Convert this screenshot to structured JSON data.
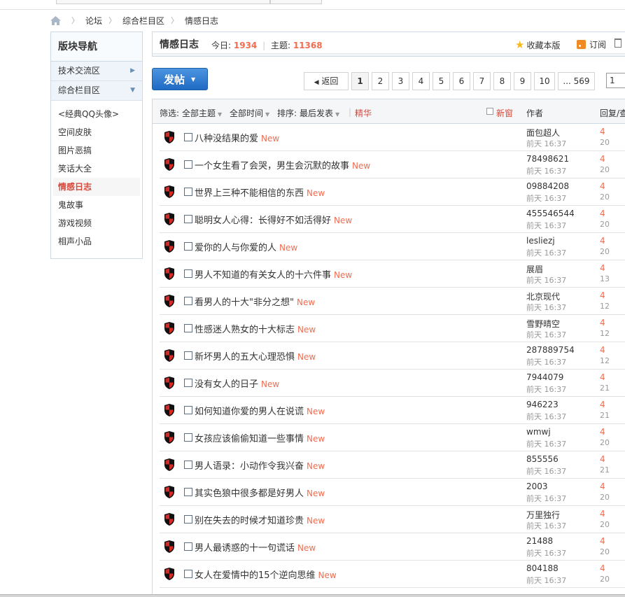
{
  "breadcrumb": {
    "items": [
      "论坛",
      "综合栏目区",
      "情感日志"
    ]
  },
  "sidebar": {
    "title": "版块导航",
    "groups": [
      {
        "label": "技术交流区",
        "arrow": "▶"
      },
      {
        "label": "综合栏目区",
        "arrow": "▼"
      }
    ],
    "items": [
      {
        "label": "<经典QQ头像>"
      },
      {
        "label": "空间皮肤"
      },
      {
        "label": "图片恶搞"
      },
      {
        "label": "笑话大全"
      },
      {
        "label": "情感日志",
        "active": true
      },
      {
        "label": "鬼故事"
      },
      {
        "label": "游戏视频"
      },
      {
        "label": "相声小品"
      }
    ]
  },
  "forum": {
    "name": "情感日志",
    "today_label": "今日:",
    "today_value": "1934",
    "threads_label": "主题:",
    "threads_value": "11368",
    "favorite_label": "收藏本版",
    "subscribe_label": "订阅"
  },
  "post_button": {
    "label": "发帖"
  },
  "pager": {
    "back": "返回",
    "pages": [
      "1",
      "2",
      "3",
      "4",
      "5",
      "6",
      "7",
      "8",
      "9",
      "10",
      "... 569"
    ],
    "current": "1",
    "input_value": "1"
  },
  "filters": {
    "filter_label": "筛选:",
    "all_threads": "全部主题",
    "all_time": "全部时间",
    "sort_label": "排序:",
    "sort_value": "最后发表",
    "digest": "精华",
    "new_window": "新窗",
    "col_author": "作者",
    "col_replies": "回复/查"
  },
  "new_badge": "New",
  "threads": [
    {
      "title": "八种没结果的爱",
      "author": "面包超人",
      "time": "前天 16:37",
      "replies": "4",
      "views": "20"
    },
    {
      "title": "一个女生看了会哭，男生会沉默的故事",
      "author": "78498621",
      "time": "前天 16:37",
      "replies": "4",
      "views": "20"
    },
    {
      "title": "世界上三种不能相信的东西",
      "author": "09884208",
      "time": "前天 16:37",
      "replies": "4",
      "views": "20"
    },
    {
      "title": "聪明女人心得：长得好不如活得好",
      "author": "455546544",
      "time": "前天 16:37",
      "replies": "4",
      "views": "20"
    },
    {
      "title": "爱你的人与你爱的人",
      "author": "lesliezj",
      "time": "前天 16:37",
      "replies": "4",
      "views": "20"
    },
    {
      "title": "男人不知道的有关女人的十六件事",
      "author": "展眉",
      "time": "前天 16:37",
      "replies": "4",
      "views": "13"
    },
    {
      "title": "看男人的十大\"非分之想\"",
      "author": "北京现代",
      "time": "前天 16:37",
      "replies": "4",
      "views": "12"
    },
    {
      "title": "性感迷人熟女的十大标志",
      "author": "雪野晴空",
      "time": "前天 16:37",
      "replies": "4",
      "views": "12"
    },
    {
      "title": "新坏男人的五大心理恐惧",
      "author": "287889754",
      "time": "前天 16:37",
      "replies": "4",
      "views": "12"
    },
    {
      "title": "没有女人的日子",
      "author": "7944079",
      "time": "前天 16:37",
      "replies": "4",
      "views": "21"
    },
    {
      "title": "如何知道你爱的男人在说谎",
      "author": "946223",
      "time": "前天 16:37",
      "replies": "4",
      "views": "21"
    },
    {
      "title": "女孩应该偷偷知道一些事情",
      "author": "wmwj",
      "time": "前天 16:37",
      "replies": "4",
      "views": "20"
    },
    {
      "title": "男人语录：小动作令我兴奋",
      "author": "855556",
      "time": "前天 16:37",
      "replies": "4",
      "views": "21"
    },
    {
      "title": "其实色狼中很多都是好男人",
      "author": "2003",
      "time": "前天 16:37",
      "replies": "4",
      "views": "20"
    },
    {
      "title": "别在失去的时候才知道珍贵",
      "author": "万里独行",
      "time": "前天 16:37",
      "replies": "4",
      "views": "20"
    },
    {
      "title": "男人最诱惑的十一句谎话",
      "author": "21488",
      "time": "前天 16:37",
      "replies": "4",
      "views": "20"
    },
    {
      "title": "女人在爱情中的15个逆向思维",
      "author": "804188",
      "time": "前天 16:37",
      "replies": "4",
      "views": "20"
    }
  ],
  "colors": {
    "accent": "#f26c4f",
    "active": "#d54a3c",
    "button": "#2a78d0",
    "border": "#cdd9e5"
  }
}
